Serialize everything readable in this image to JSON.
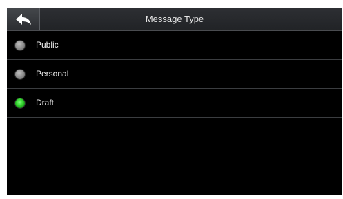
{
  "header": {
    "title": "Message Type",
    "back_icon": "back-arrow-icon"
  },
  "options": [
    {
      "label": "Public",
      "selected": false
    },
    {
      "label": "Personal",
      "selected": false
    },
    {
      "label": "Draft",
      "selected": true
    }
  ],
  "colors": {
    "screen_bg": "#000000",
    "header_bg": "#2a2c30",
    "divider": "#3b3d40",
    "radio_on": "#2fcf2a",
    "radio_off": "#8a8a8a",
    "text": "#f0f0f0"
  }
}
